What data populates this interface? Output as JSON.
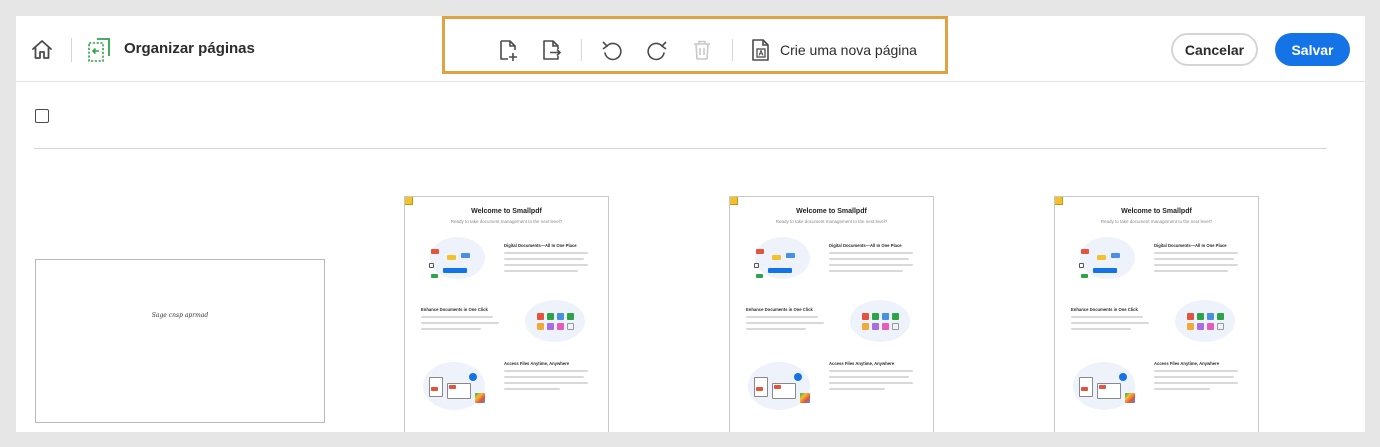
{
  "header": {
    "title": "Organizar páginas",
    "cancel_label": "Cancelar",
    "save_label": "Salvar"
  },
  "toolbar": {
    "new_page_label": "Crie uma nova página"
  },
  "icons": {
    "home": "home-icon",
    "app": "organize-pages-icon",
    "insert": "insert-page-icon",
    "extract": "extract-page-icon",
    "rotate_left": "rotate-left-icon",
    "rotate_right": "rotate-right-icon",
    "delete": "trash-icon",
    "new_page": "new-page-icon"
  },
  "colors": {
    "accent": "#1473e6",
    "toolbar_highlight": "#e0a243",
    "page_badge": "#f2c12e"
  },
  "pages": {
    "landscape_text": "Sage cnsp aprmad",
    "welcome_title": "Welcome to Smallpdf",
    "welcome_subtitle": "Ready to take document management to the next level?",
    "section1": "Digital Documents—All In One Place",
    "section2": "Enhance Documents in One Click",
    "section3": "Access Files Anytime, Anywhere"
  }
}
